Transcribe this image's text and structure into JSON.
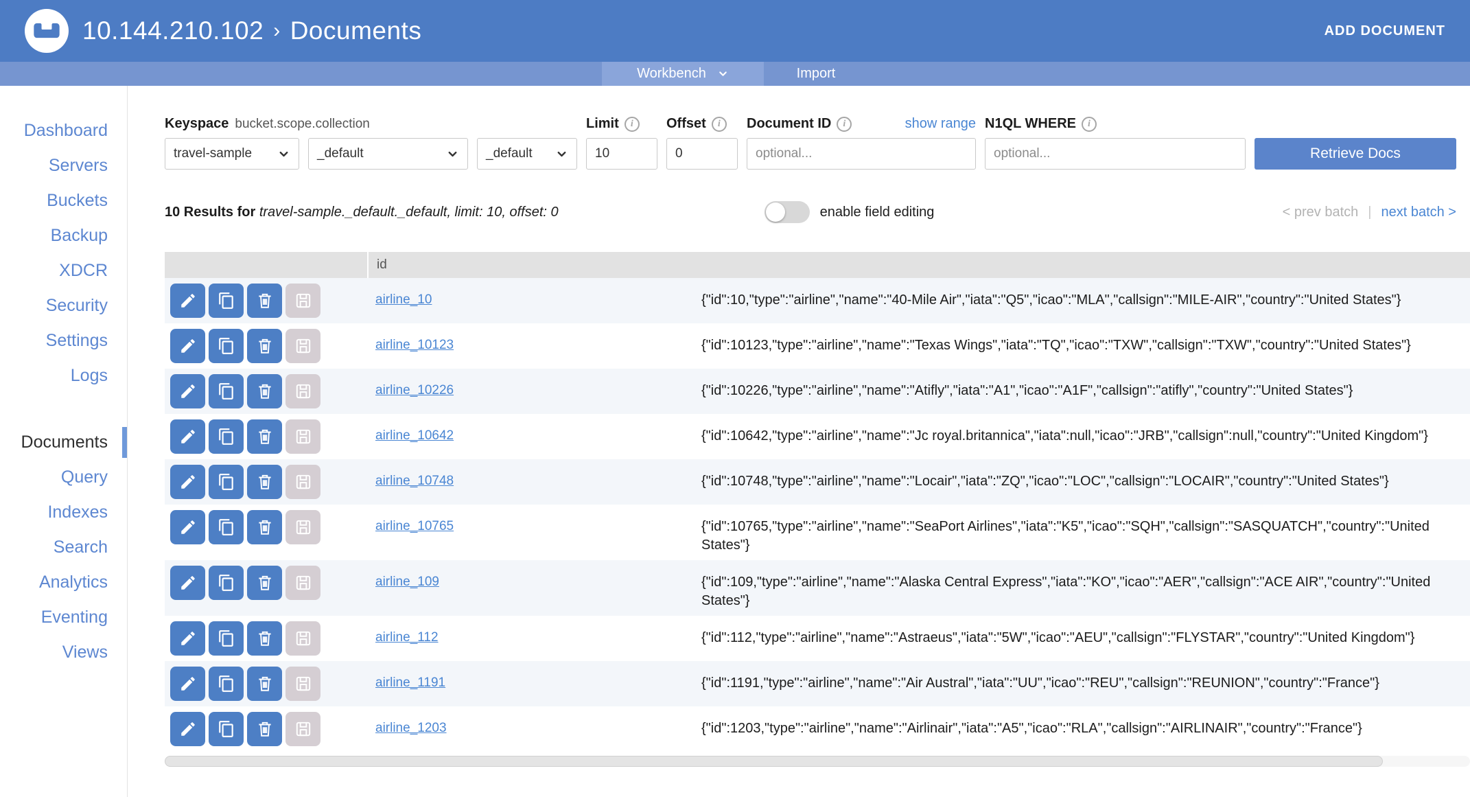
{
  "header": {
    "server": "10.144.210.102",
    "separator": "›",
    "section": "Documents",
    "add_document_label": "ADD DOCUMENT"
  },
  "subnav": {
    "tabs": [
      {
        "label": "Workbench",
        "active": true
      },
      {
        "label": "Import",
        "active": false
      }
    ]
  },
  "sidebar": {
    "top": [
      {
        "label": "Dashboard"
      },
      {
        "label": "Servers"
      },
      {
        "label": "Buckets"
      },
      {
        "label": "Backup"
      },
      {
        "label": "XDCR"
      },
      {
        "label": "Security"
      },
      {
        "label": "Settings"
      },
      {
        "label": "Logs"
      }
    ],
    "docs": [
      {
        "label": "Documents",
        "active": true
      },
      {
        "label": "Query"
      },
      {
        "label": "Indexes"
      },
      {
        "label": "Search"
      },
      {
        "label": "Analytics"
      },
      {
        "label": "Eventing"
      },
      {
        "label": "Views"
      }
    ]
  },
  "controls": {
    "keyspace_label": "Keyspace",
    "keyspace_hint": "bucket.scope.collection",
    "bucket_select": {
      "value": "travel-sample"
    },
    "scope_select": {
      "value": "_default"
    },
    "collection_select": {
      "value": "_default"
    },
    "limit": {
      "label": "Limit",
      "value": "10"
    },
    "offset": {
      "label": "Offset",
      "value": "0"
    },
    "document_id": {
      "label": "Document ID",
      "placeholder": "optional..."
    },
    "show_range_label": "show range",
    "n1ql_where": {
      "label": "N1QL WHERE",
      "placeholder": "optional..."
    },
    "retrieve_button_label": "Retrieve Docs"
  },
  "results_bar": {
    "count_text": "10 Results for",
    "detail_text": "travel-sample._default._default, limit: 10, offset: 0",
    "field_editing_label": "enable field editing",
    "field_editing_enabled": false,
    "prev_label": "< prev batch",
    "separator": "|",
    "next_label": "next batch >"
  },
  "table": {
    "id_header": "id",
    "row_actions": [
      "edit",
      "copy",
      "delete",
      "save"
    ],
    "rows": [
      {
        "id": "airline_10",
        "json": "{\"id\":10,\"type\":\"airline\",\"name\":\"40-Mile Air\",\"iata\":\"Q5\",\"icao\":\"MLA\",\"callsign\":\"MILE-AIR\",\"country\":\"United States\"}"
      },
      {
        "id": "airline_10123",
        "json": "{\"id\":10123,\"type\":\"airline\",\"name\":\"Texas Wings\",\"iata\":\"TQ\",\"icao\":\"TXW\",\"callsign\":\"TXW\",\"country\":\"United States\"}"
      },
      {
        "id": "airline_10226",
        "json": "{\"id\":10226,\"type\":\"airline\",\"name\":\"Atifly\",\"iata\":\"A1\",\"icao\":\"A1F\",\"callsign\":\"atifly\",\"country\":\"United States\"}"
      },
      {
        "id": "airline_10642",
        "json": "{\"id\":10642,\"type\":\"airline\",\"name\":\"Jc royal.britannica\",\"iata\":null,\"icao\":\"JRB\",\"callsign\":null,\"country\":\"United Kingdom\"}"
      },
      {
        "id": "airline_10748",
        "json": "{\"id\":10748,\"type\":\"airline\",\"name\":\"Locair\",\"iata\":\"ZQ\",\"icao\":\"LOC\",\"callsign\":\"LOCAIR\",\"country\":\"United States\"}"
      },
      {
        "id": "airline_10765",
        "json": "{\"id\":10765,\"type\":\"airline\",\"name\":\"SeaPort Airlines\",\"iata\":\"K5\",\"icao\":\"SQH\",\"callsign\":\"SASQUATCH\",\"country\":\"United States\"}"
      },
      {
        "id": "airline_109",
        "json": "{\"id\":109,\"type\":\"airline\",\"name\":\"Alaska Central Express\",\"iata\":\"KO\",\"icao\":\"AER\",\"callsign\":\"ACE AIR\",\"country\":\"United States\"}"
      },
      {
        "id": "airline_112",
        "json": "{\"id\":112,\"type\":\"airline\",\"name\":\"Astraeus\",\"iata\":\"5W\",\"icao\":\"AEU\",\"callsign\":\"FLYSTAR\",\"country\":\"United Kingdom\"}"
      },
      {
        "id": "airline_1191",
        "json": "{\"id\":1191,\"type\":\"airline\",\"name\":\"Air Austral\",\"iata\":\"UU\",\"icao\":\"REU\",\"callsign\":\"REUNION\",\"country\":\"France\"}"
      },
      {
        "id": "airline_1203",
        "json": "{\"id\":1203,\"type\":\"airline\",\"name\":\"Airlinair\",\"iata\":\"A5\",\"icao\":\"RLA\",\"callsign\":\"AIRLINAIR\",\"country\":\"France\"}"
      }
    ]
  },
  "colors": {
    "header_bg": "#4d7cc4",
    "subnav_bg": "#7695d0",
    "subnav_active_bg": "#8aa5da",
    "link_blue": "#4a86d3",
    "sidebar_link": "#5d87d1",
    "button_blue": "#4d7fc5",
    "retrieve_blue": "#5b84cb",
    "disabled_button": "#d5ced3",
    "row_alt_bg": "#f3f6fa",
    "table_header_bg": "#e2e2e2"
  }
}
